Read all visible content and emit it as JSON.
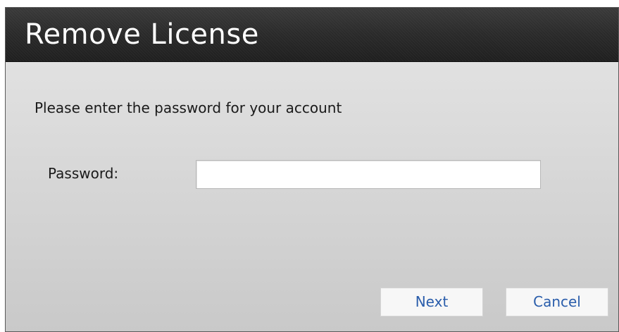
{
  "dialog": {
    "title": "Remove License",
    "prompt": "Please enter the password for your account",
    "password_label": "Password:",
    "password_value": "",
    "next_label": "Next",
    "cancel_label": "Cancel"
  },
  "colors": {
    "title_bar": "#2b2b2b",
    "title_text": "#ffffff",
    "body_background": "#d6d6d6",
    "button_text": "#2a5dab"
  }
}
